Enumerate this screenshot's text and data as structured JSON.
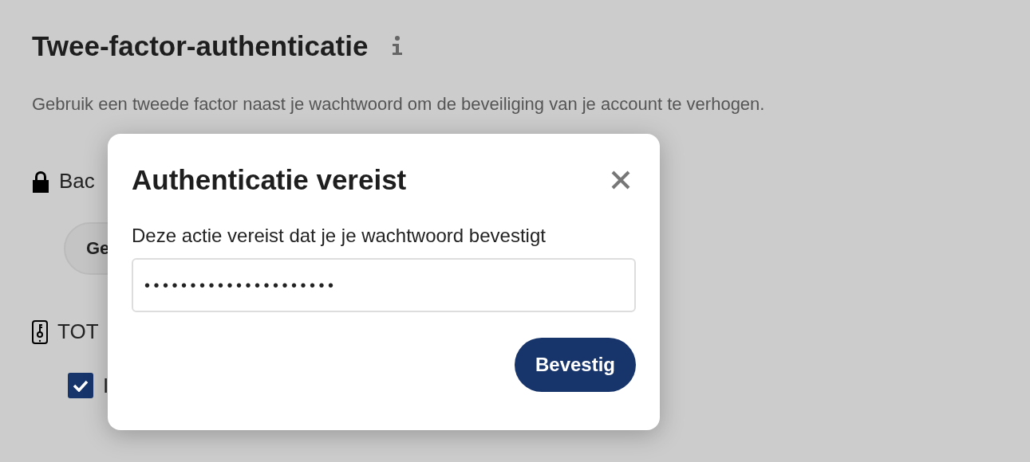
{
  "page": {
    "title": "Twee-factor-authenticatie",
    "description": "Gebruik een tweede factor naast je wachtwoord om de beveiliging van je account te verhogen."
  },
  "sections": [
    {
      "kind": "backup",
      "heading": "Bac",
      "button": "Ge"
    },
    {
      "kind": "totp",
      "heading": "TOT",
      "checkbox": {
        "label": "I",
        "checked": true
      }
    }
  ],
  "dialog": {
    "title": "Authenticatie vereist",
    "message": "Deze actie vereist dat je je wachtwoord bevestigt",
    "password_masked": "•••••••••••••••••••••",
    "confirm_button": "Bevestig"
  }
}
